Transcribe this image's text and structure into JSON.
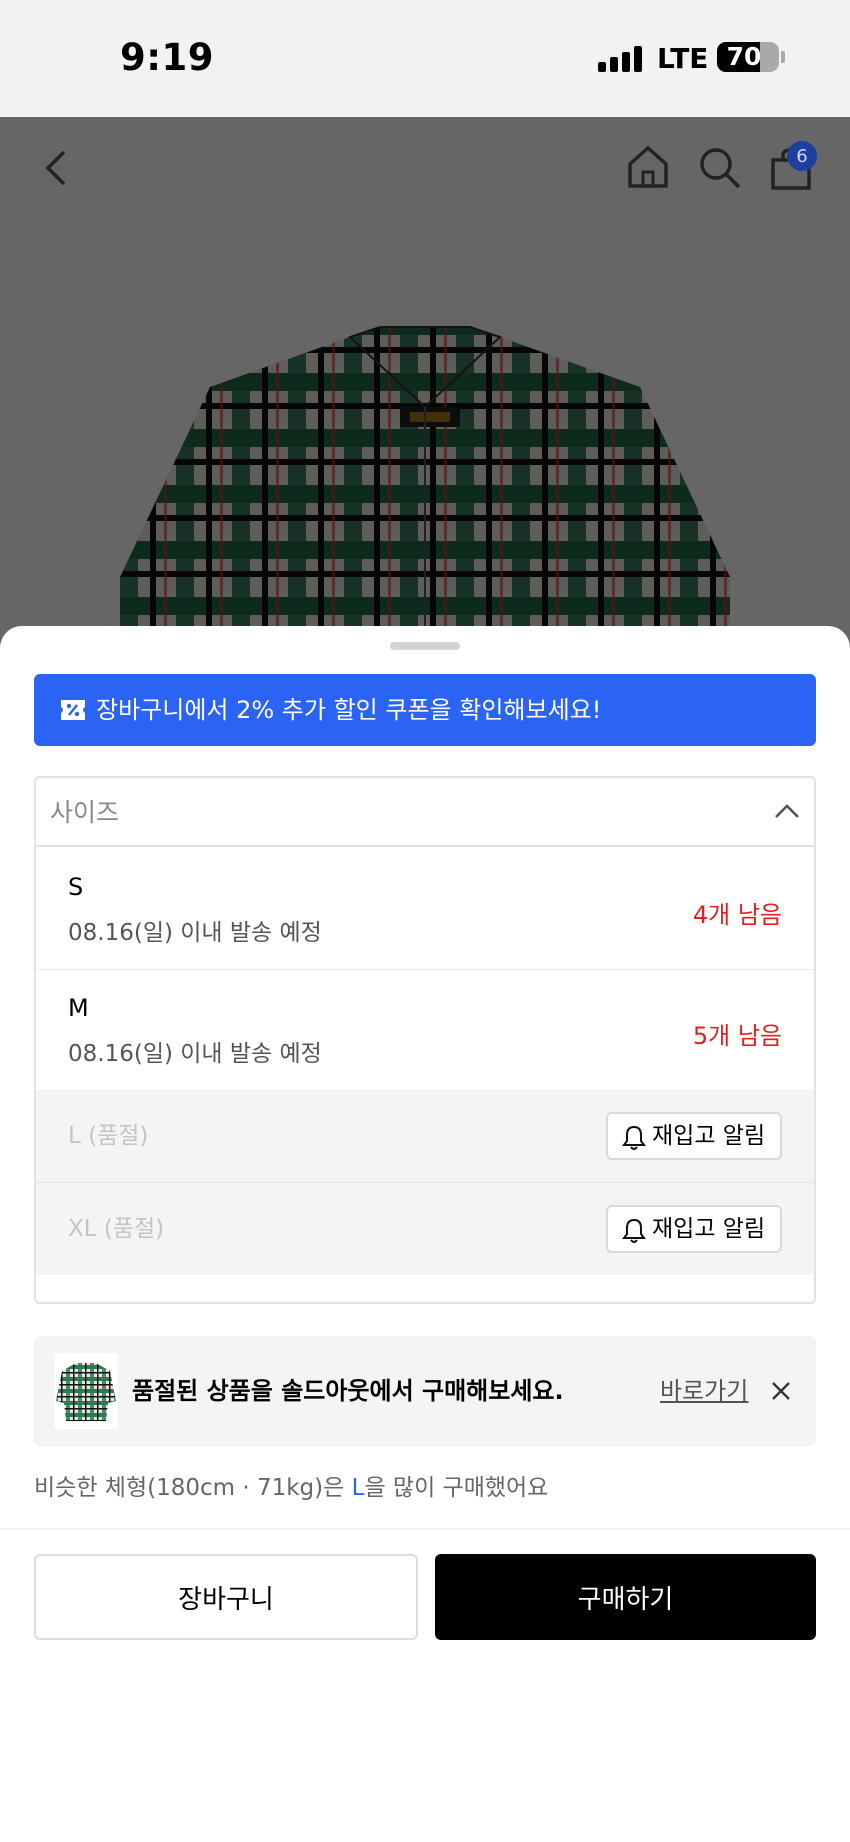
{
  "status_bar": {
    "time": "9:19",
    "network": "LTE",
    "battery": "70",
    "battery_level": 0.7
  },
  "top_nav": {
    "icons": [
      "back-icon",
      "home-icon",
      "search-icon",
      "bag-icon"
    ],
    "cart_count": "6",
    "badge_color": "#2244aa"
  },
  "sheet": {
    "coupon_banner": {
      "text": "장바구니에서 2% 추가 할인 쿠폰을 확인해보세요!",
      "color": "#2b63f5"
    },
    "size_selector": {
      "label": "사이즈",
      "options": [
        {
          "name": "S",
          "shipping": "08.16(일) 이내 발송 예정",
          "stock": "4개 남음"
        },
        {
          "name": "M",
          "shipping": "08.16(일) 이내 발송 예정",
          "stock": "5개 남음"
        }
      ],
      "soldout_options": [
        {
          "name": "L (품절)",
          "action": "재입고 알림"
        },
        {
          "name": "XL (품절)",
          "action": "재입고 알림"
        }
      ]
    },
    "soldout_banner": {
      "text": "품절된 상품을 솔드아웃에서 구매해보세요.",
      "link": "바로가기"
    },
    "recommendation": {
      "prefix": "비슷한 체형(180cm · 71kg)은 ",
      "size": "L",
      "suffix": "을 많이 구매했어요"
    },
    "buttons": {
      "cart": "장바구니",
      "buy": "구매하기"
    }
  }
}
